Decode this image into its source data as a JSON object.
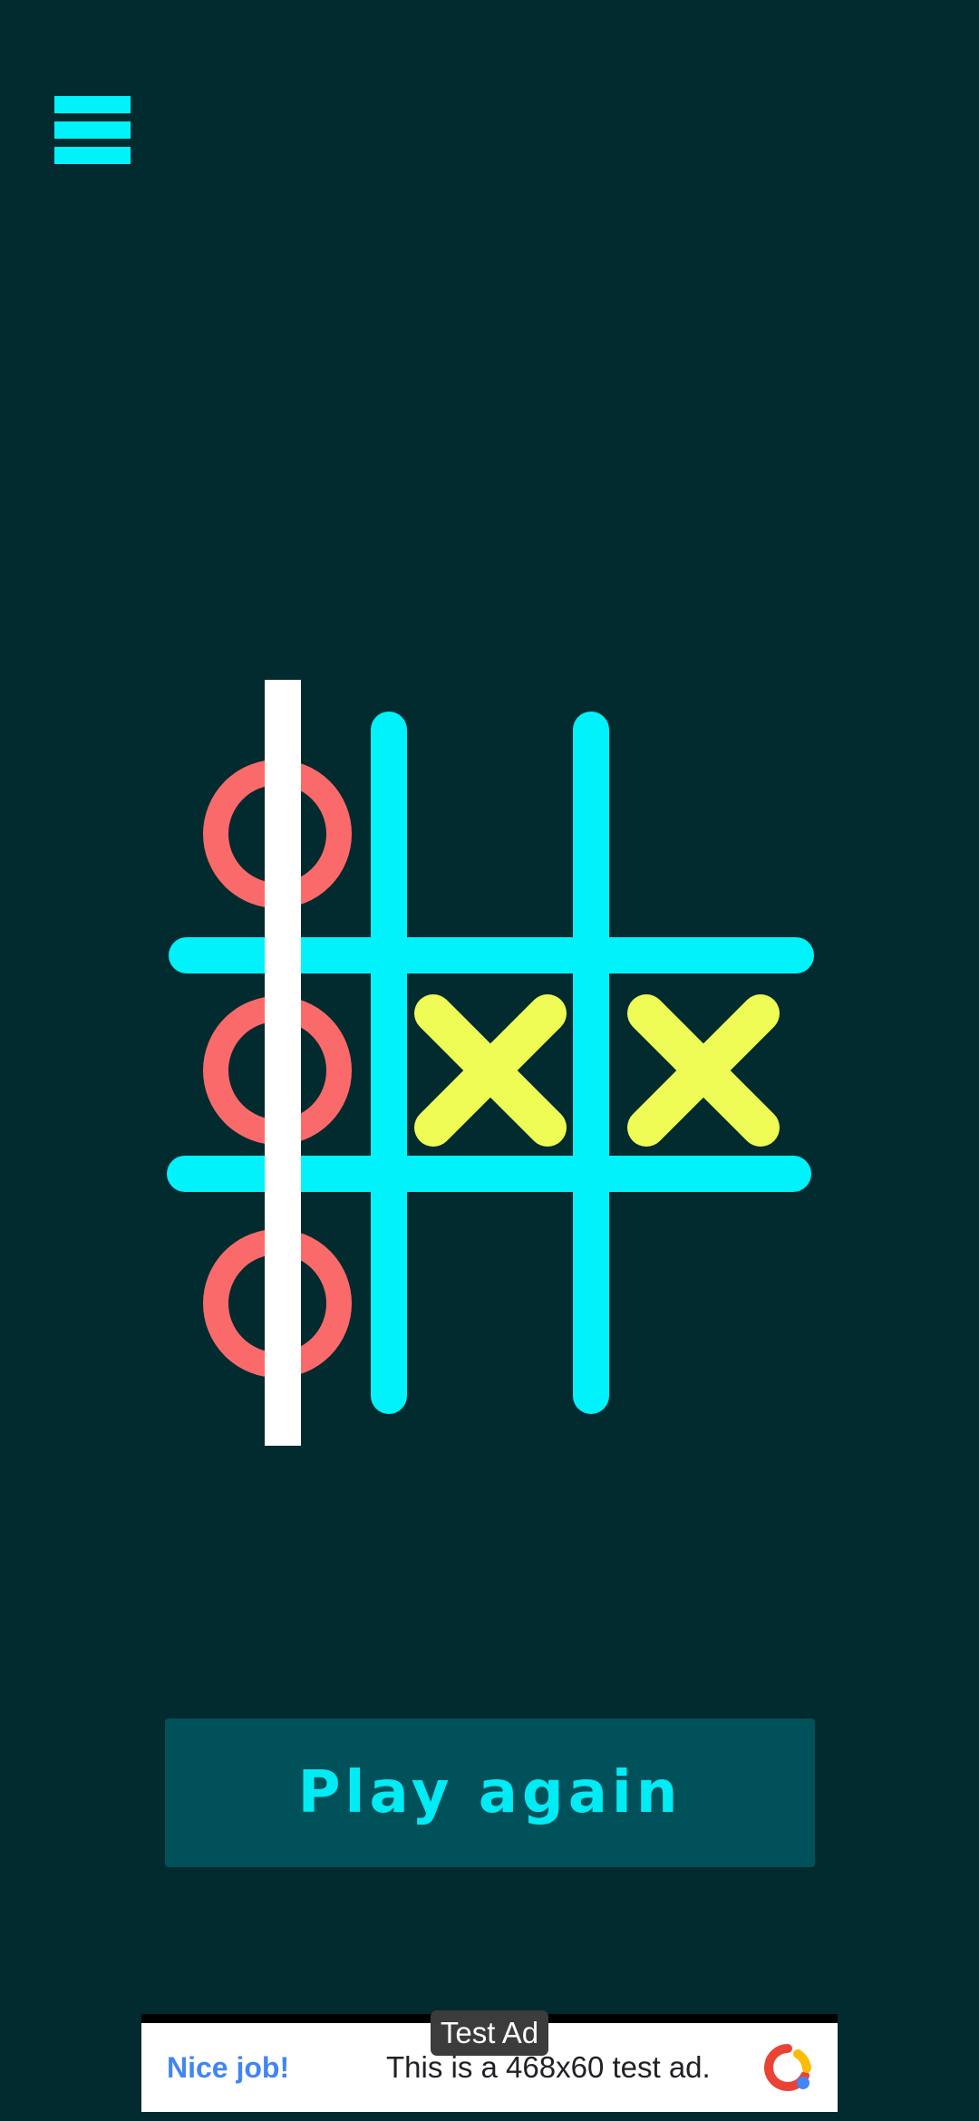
{
  "menu": {
    "icon": "hamburger-menu-icon"
  },
  "board": {
    "cells": [
      [
        "O",
        "",
        ""
      ],
      [
        "O",
        "X",
        "X"
      ],
      [
        "O",
        "",
        ""
      ]
    ],
    "winning_line": "column-1",
    "colors": {
      "grid": "#00f3fb",
      "o": "#fa6a6a",
      "x": "#eefc55",
      "strike": "#ffffff",
      "background": "#022b2f"
    }
  },
  "actions": {
    "play_again_label": "Play again"
  },
  "ad": {
    "badge": "Test Ad",
    "headline": "Nice job!",
    "body": "This is a 468x60 test ad.",
    "logo_icon": "adchoices-logo-icon"
  }
}
